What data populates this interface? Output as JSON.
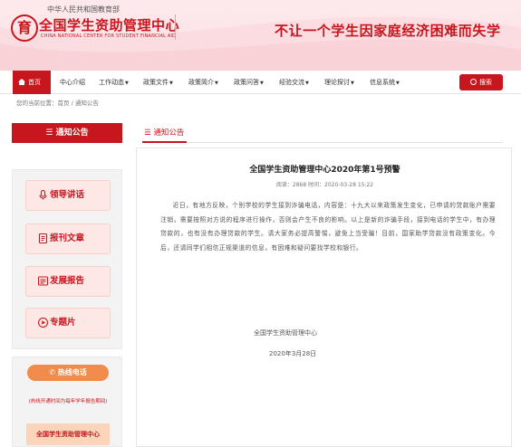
{
  "header": {
    "logo_glyph": "育",
    "logo_upper": "中华人民共和国教育部",
    "logo_main": "全国学生资助管理中心",
    "logo_en": "CHINA NATIONAL CENTER FOR STUDENT FINANCIAL AID",
    "slogan": "不让一个学生因家庭经济困难而失学"
  },
  "nav": {
    "items": [
      {
        "label": "首页"
      },
      {
        "label": "中心介绍"
      },
      {
        "label": "工作动态"
      },
      {
        "label": "政策文件"
      },
      {
        "label": "政策简介"
      },
      {
        "label": "政策问答"
      },
      {
        "label": "经验交流"
      },
      {
        "label": "理论探讨"
      },
      {
        "label": "信息系统"
      }
    ],
    "search_label": "搜索"
  },
  "breadcrumb": "您的当前位置：首页 / 通知公告",
  "sidebar": {
    "title": "通知公告",
    "buttons": [
      {
        "label": "领导讲话",
        "icon": "microphone-icon"
      },
      {
        "label": "报刊文章",
        "icon": "document-icon"
      },
      {
        "label": "发展报告",
        "icon": "report-icon"
      },
      {
        "label": "专题片",
        "icon": "play-icon"
      }
    ],
    "hotline_label": "热线电话",
    "hotline_note": "(热线开通时间为每年学年报告期间)",
    "hotline_center": "全国学生资助管理中心"
  },
  "main": {
    "tab_label": "通知公告",
    "title": "全国学生资助管理中心2020年第1号预警",
    "meta": "阅读：2868 时间：2020-03-28 15:22",
    "body": "近日，有地方反映，个别学校的学生接到诈骗电话，内容是：十九大以来政策发生变化，已申请的贷款账户需要注销，需要按照对方说的程序进行操作，否则会产生不良的影响。以上是新的诈骗手段，接到电话的学生中，有办理贷款的，也有没有办理贷款的学生。请大家务必提高警惕，避免上当受骗！目前，国家助学贷款没有政策变化。今后，还请同学们相信正规渠道的信息，有困难和疑问要找学校和银行。",
    "signature": "全国学生资助管理中心",
    "date": "2020年3月28日"
  },
  "colors": {
    "brand_red": "#c8161e",
    "hotline_orange": "#f08b4c"
  }
}
